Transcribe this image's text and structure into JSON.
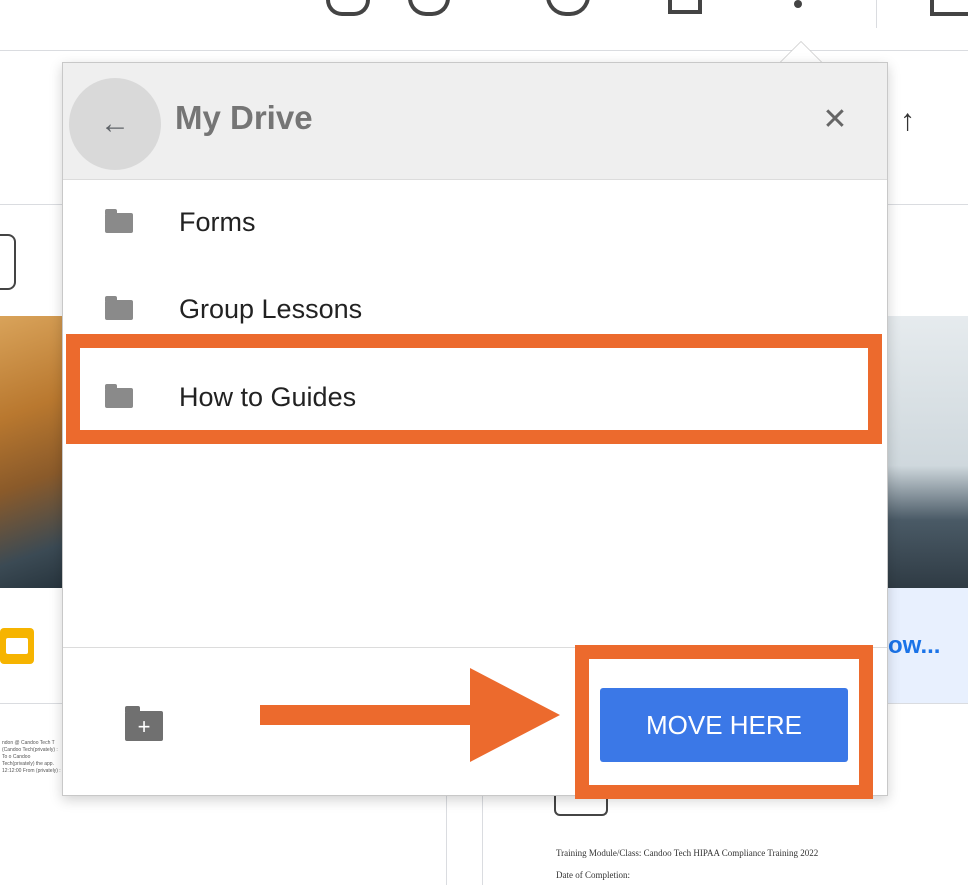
{
  "dialog": {
    "title": "My Drive",
    "back_icon": "←",
    "close_icon": "✕",
    "folders": [
      {
        "label": "Forms",
        "icon": "folder-icon"
      },
      {
        "label": "Group Lessons",
        "icon": "folder-icon"
      },
      {
        "label": "How to Guides",
        "icon": "folder-icon"
      }
    ],
    "new_folder_icon": "+",
    "move_button": "MOVE HERE"
  },
  "background": {
    "up_arrow": "↑",
    "card_link_text": "ow...",
    "doc_line1": "Training Module/Class: Candoo Tech HIPAA Compliance Training 2022",
    "doc_line2": "Date of Completion:",
    "chat_snippet": "ndon @ Candoo Tech T (Candoo Tech(privately) : To o Candoo Tech(privately) the app. 12:12:00 From (privately) :"
  },
  "annotation_color": "#ec6a2d",
  "accent_color": "#3b78e7"
}
